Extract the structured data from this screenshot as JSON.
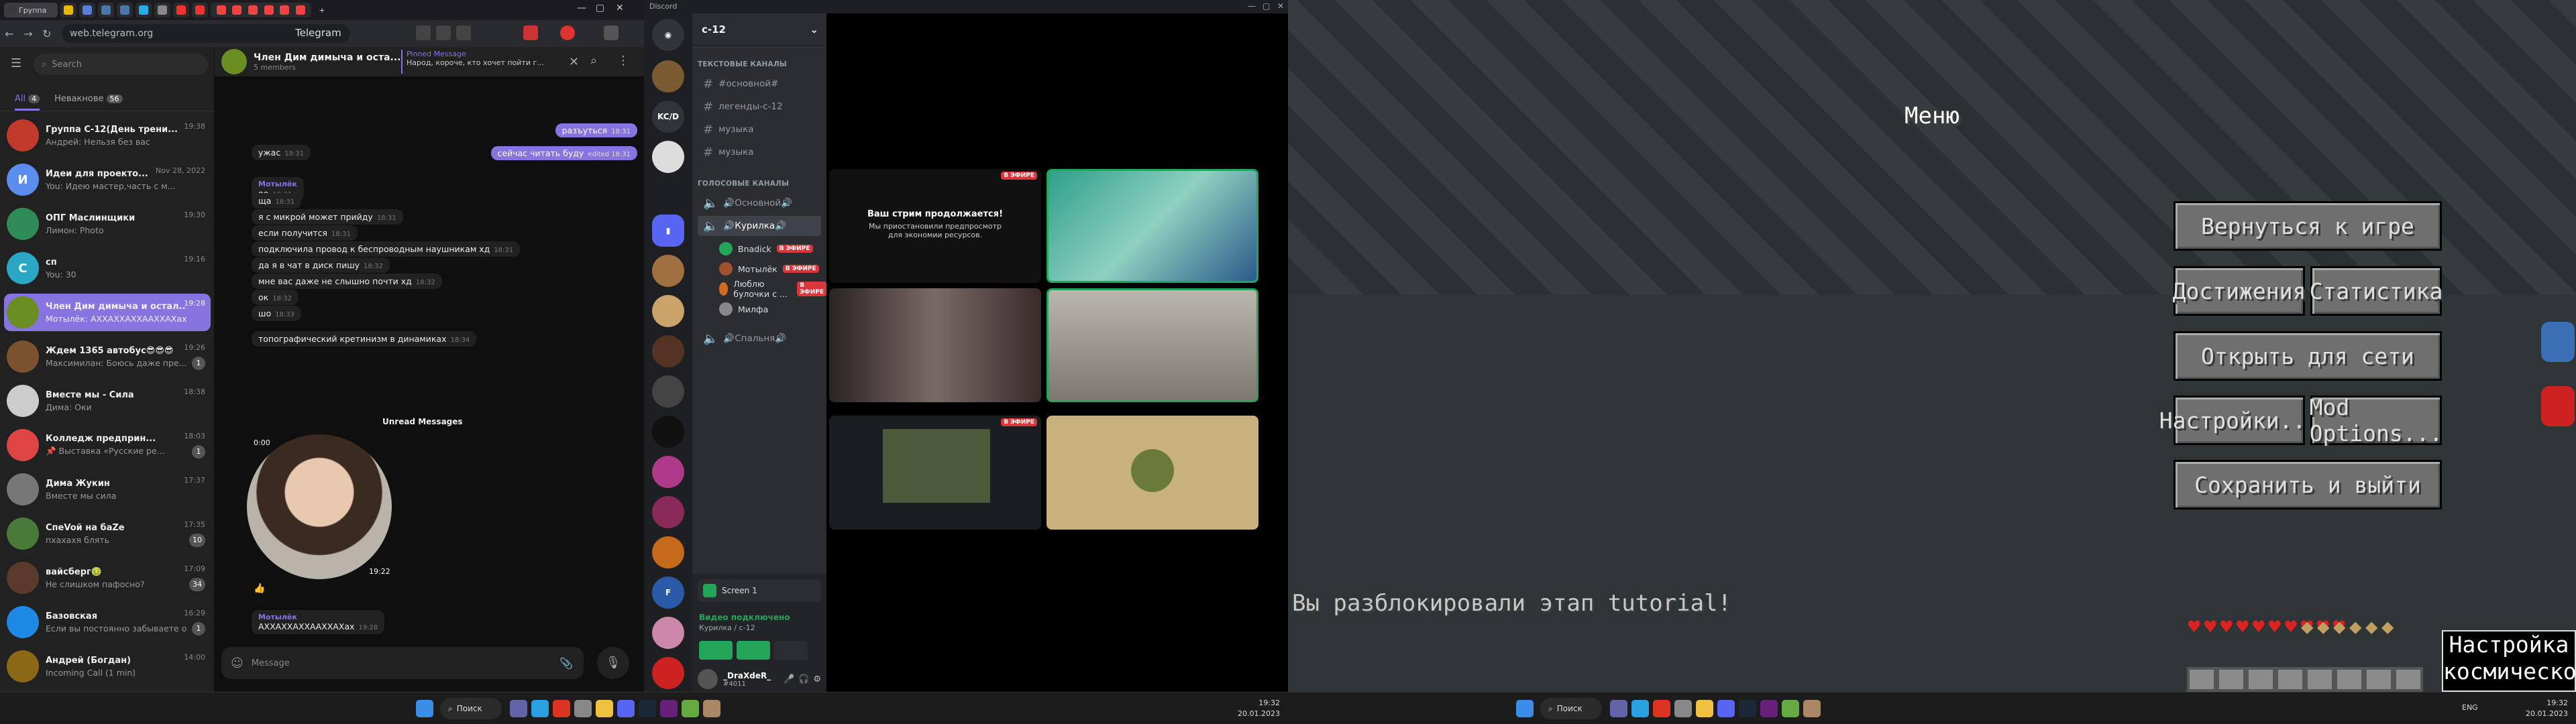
{
  "browser": {
    "tab_label": "Группа",
    "url": "web.telegram.org",
    "page_title": "Telegram",
    "win_min": "—",
    "win_max": "▢",
    "win_close": "✕"
  },
  "telegram": {
    "search_placeholder": "Search",
    "folders": [
      {
        "label": "All",
        "count": "4"
      },
      {
        "label": "Невакнове",
        "count": "56"
      }
    ],
    "chats": [
      {
        "name": "Группа С-12(День трени...",
        "preview": "Андрей: Нельзя без вас",
        "time": "19:38",
        "color": "#c0392b",
        "initials": ""
      },
      {
        "name": "Идеи для проекто...",
        "preview": "You: Идею мастер,часть с м...",
        "time": "Nov 28, 2022",
        "color": "#5b8def",
        "initials": "И"
      },
      {
        "name": "ОПГ Маслинщики",
        "preview": "Лимон: Photo",
        "time": "19:30",
        "color": "#2e8b57",
        "initials": ""
      },
      {
        "name": "сп",
        "preview": "You: 30",
        "time": "19:16",
        "color": "#29a7c4",
        "initials": "С"
      },
      {
        "name": "Член Дим димыча и остал...",
        "preview": "Мотылёк: АХХАХХАХХААХХАХах",
        "time": "19:28",
        "color": "#6b8e23",
        "initials": "",
        "selected": true
      },
      {
        "name": "Ждем 1365 автобус😎😎😎",
        "preview": "Максимилан: Боюсь даже пре...",
        "time": "19:26",
        "color": "#7a5230",
        "initials": "",
        "badge": "1"
      },
      {
        "name": "Вместе мы - Сила",
        "preview": "Дима: Оки",
        "time": "18:38",
        "color": "#ccc",
        "initials": ""
      },
      {
        "name": "Колледж предприн...",
        "preview": "📌 Выставка «Русские ре...",
        "time": "18:03",
        "color": "#d44",
        "initials": "",
        "badge": "1"
      },
      {
        "name": "Дима Жукин",
        "preview": "Вместе мы сила",
        "time": "17:37",
        "color": "#777",
        "initials": ""
      },
      {
        "name": "СпеVoй на баZе",
        "preview": "пхахахя блять",
        "time": "17:35",
        "color": "#4a7a3a",
        "initials": "",
        "badge": "10"
      },
      {
        "name": "вайсберг🤢",
        "preview": "Не слишком пафосно?",
        "time": "17:09",
        "color": "#5a3a2a",
        "initials": "",
        "badge": "34"
      },
      {
        "name": "Базовская",
        "preview": "Если вы постоянно забываете о...",
        "time": "16:29",
        "color": "#1e88e5",
        "initials": "",
        "badge": "1"
      },
      {
        "name": "Андрей (Богдан)",
        "preview": "Incoming Call (1 min)",
        "time": "14:00",
        "color": "#8b6914",
        "initials": ""
      }
    ],
    "header": {
      "title": "Член Дим димыча и оста...",
      "subtitle": "5 members",
      "pinned_label": "Pinned Message",
      "pinned_text": "Народ, короче, кто хочет пойти г..."
    },
    "messages": [
      {
        "text": "ужас",
        "time": "18:31"
      },
      {
        "sender": "Мотылёк",
        "text": "оо",
        "time": "18:31"
      },
      {
        "text": "ща",
        "time": "18:31"
      },
      {
        "text": "я с микрой может прийду",
        "time": "18:31"
      },
      {
        "text": "если получится",
        "time": "18:31"
      },
      {
        "text": "подключила провод к беспроводным наушникам хд",
        "time": "18:31"
      },
      {
        "text": "да я в чат в диск пишу",
        "time": "18:32"
      },
      {
        "text": "мне вас даже не слышно почти хд",
        "time": "18:32"
      },
      {
        "text": "ок",
        "time": "18:32"
      },
      {
        "text": "шо",
        "time": "18:33"
      },
      {
        "text": "топографический кретинизм в динамиках",
        "time": "18:34"
      }
    ],
    "outgoing": [
      {
        "text": "разъуться",
        "time": "18:31"
      },
      {
        "text": "сейчас читать буду",
        "time": "edited 18:31"
      }
    ],
    "unread_label": "Unread Messages",
    "video_time": "0:00",
    "video_stamp": "19:22",
    "last_sender": "Мотылёк",
    "last_text": "АХХАХХАХХААХХАХах",
    "last_time": "19:28",
    "composer_placeholder": "Message"
  },
  "discord": {
    "app_title": "Discord",
    "server_name": "с-12",
    "text_category": "ТЕКСТОВЫЕ КАНАЛЫ",
    "text_channels": [
      "#основной#",
      "легенды-с-12",
      "музыка",
      "музыка"
    ],
    "voice_category": "ГОЛОСОВЫЕ КАНАЛЫ",
    "voice_channels": [
      {
        "name": "🔊Основной🔊"
      },
      {
        "name": "🔊Курилка🔊",
        "selected": true
      },
      {
        "name": "🔊Спальня🔊"
      }
    ],
    "voice_users": [
      {
        "name": "Bnadick",
        "live": "В ЭФИРЕ"
      },
      {
        "name": "Мотылёк",
        "live": "В ЭФИРЕ"
      },
      {
        "name": "Люблю булочки с ...",
        "live": "В ЭФИРЕ"
      },
      {
        "name": "Милфа",
        "live": ""
      }
    ],
    "stream_notice_title": "Ваш стрим продолжается!",
    "stream_notice_body": "Мы приостановили предпросмотр для экономии ресурсов.",
    "live_label": "В ЭФИРЕ",
    "screen_share": "Screen 1",
    "voice_status": "Видео подключено",
    "voice_sub": "Курилка / с-12",
    "username": "_DraXdeR_",
    "user_tag": "#4011"
  },
  "minecraft": {
    "menu_title": "Меню",
    "buttons": {
      "back": "Вернуться к игре",
      "achievements": "Достижения",
      "stats": "Статистика",
      "lan": "Открыть для сети",
      "settings": "Настройки...",
      "mods": "Mod Options...",
      "save": "Сохранить и выйти"
    },
    "toast": "Вы разблокировали этап tutorial!",
    "panel": "Настройка космической гонки"
  },
  "taskbar": {
    "search_label": "Поиск",
    "left_time": "19:32",
    "left_date": "20.01.2023",
    "right_lang": "ENG",
    "right_time": "19:32",
    "right_date": "20.01.2023"
  }
}
